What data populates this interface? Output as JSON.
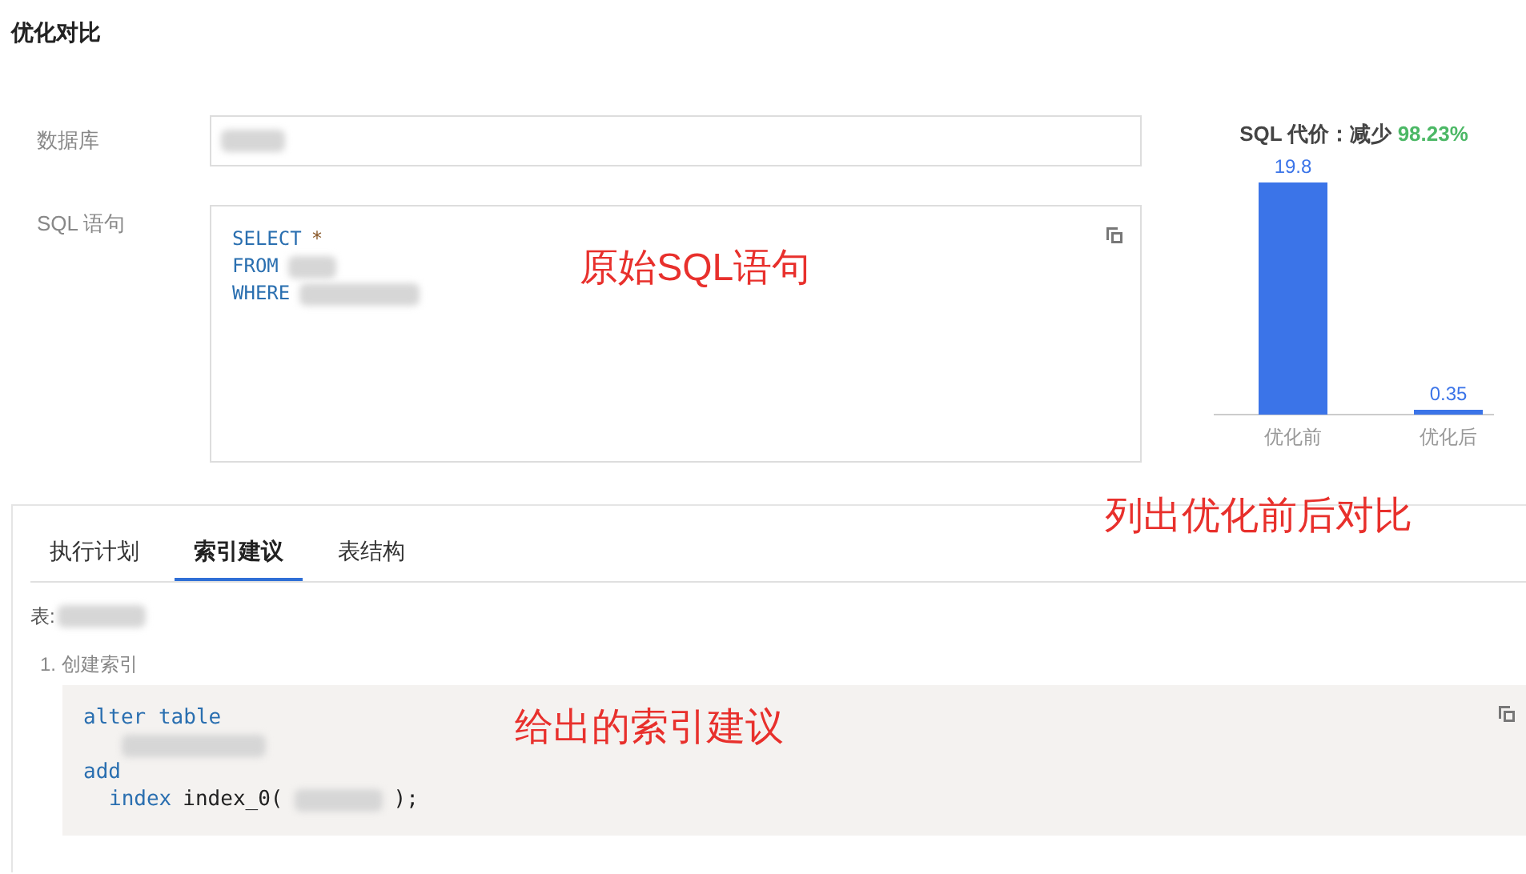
{
  "page_title": "优化对比",
  "form": {
    "database": {
      "label": "数据库"
    },
    "sql": {
      "label": "SQL 语句",
      "lines": [
        {
          "keyword": "SELECT",
          "rest": "*",
          "blurred": false
        },
        {
          "keyword": "FROM",
          "blurred": true
        },
        {
          "keyword": "WHERE",
          "blurred": true
        }
      ]
    }
  },
  "cost": {
    "title": "SQL 代价：减少",
    "value": "98.23%",
    "chart_data": {
      "type": "bar",
      "categories": [
        "优化前",
        "优化后"
      ],
      "series": [
        {
          "color": "#3b74e8",
          "values": [
            19.8,
            0.35
          ]
        }
      ],
      "data_labels": true
    }
  },
  "annotations": [
    {
      "text": "原始SQL语句"
    },
    {
      "text": "列出优化前后对比"
    },
    {
      "text": "给出的索引建议"
    }
  ],
  "tabs": [
    {
      "label": "执行计划",
      "selected": false
    },
    {
      "label": "索引建议",
      "selected": true
    },
    {
      "label": "表结构",
      "selected": false
    }
  ],
  "table_label": "表:",
  "steps": [
    {
      "title": "1. 创建索引",
      "code": [
        {
          "keyword": "alter table",
          "indent": false
        },
        {
          "keyword": "add",
          "indent": false
        },
        {
          "keyword": "index",
          "rest": "index_0(",
          "end": ");",
          "indent": true
        }
      ]
    }
  ]
}
